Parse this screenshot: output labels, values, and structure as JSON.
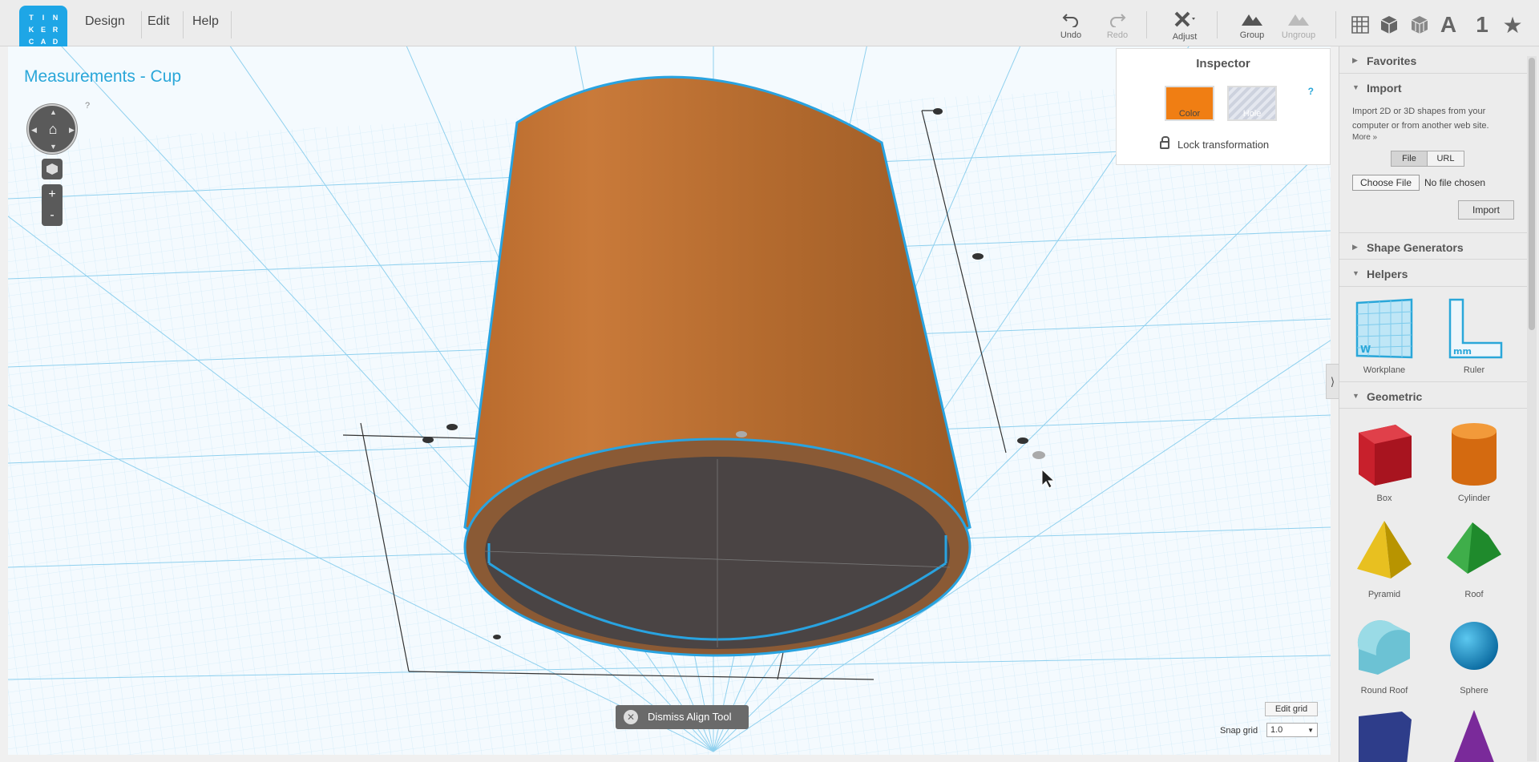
{
  "logo": {
    "letters": [
      "T",
      "I",
      "N",
      "K",
      "E",
      "R",
      "C",
      "A",
      "D"
    ]
  },
  "menu": {
    "design": "Design",
    "edit": "Edit",
    "help": "Help"
  },
  "toolbar": {
    "undo": "Undo",
    "redo": "Redo",
    "adjust": "Adjust",
    "group": "Group",
    "ungroup": "Ungroup"
  },
  "view_tools": {
    "text_icon": "A",
    "number_icon": "1",
    "star_icon": "★"
  },
  "design": {
    "title": "Measurements - Cup",
    "help": "?"
  },
  "inspector": {
    "title": "Inspector",
    "help": "?",
    "color_label": "Color",
    "hole_label": "Hole",
    "lock_label": "Lock transformation",
    "color": "#f07e13"
  },
  "align_tool": {
    "dismiss": "Dismiss Align Tool"
  },
  "grid": {
    "edit_label": "Edit grid",
    "snap_label": "Snap grid",
    "snap_value": "1.0"
  },
  "sidebar": {
    "favorites": "Favorites",
    "import": {
      "title": "Import",
      "description": "Import 2D or 3D shapes from your computer or from another web site.",
      "more": "More »",
      "file_tab": "File",
      "url_tab": "URL",
      "choose_file": "Choose File",
      "no_file": "No file chosen",
      "import_button": "Import"
    },
    "shape_generators": "Shape Generators",
    "helpers": {
      "title": "Helpers",
      "items": [
        "Workplane",
        "Ruler"
      ]
    },
    "geometric": {
      "title": "Geometric",
      "items": [
        "Box",
        "Cylinder",
        "Pyramid",
        "Roof",
        "Round Roof",
        "Sphere"
      ]
    }
  },
  "colors": {
    "accent": "#2aa7d9",
    "object": "#c97a3a",
    "selection": "#29a3e0"
  }
}
